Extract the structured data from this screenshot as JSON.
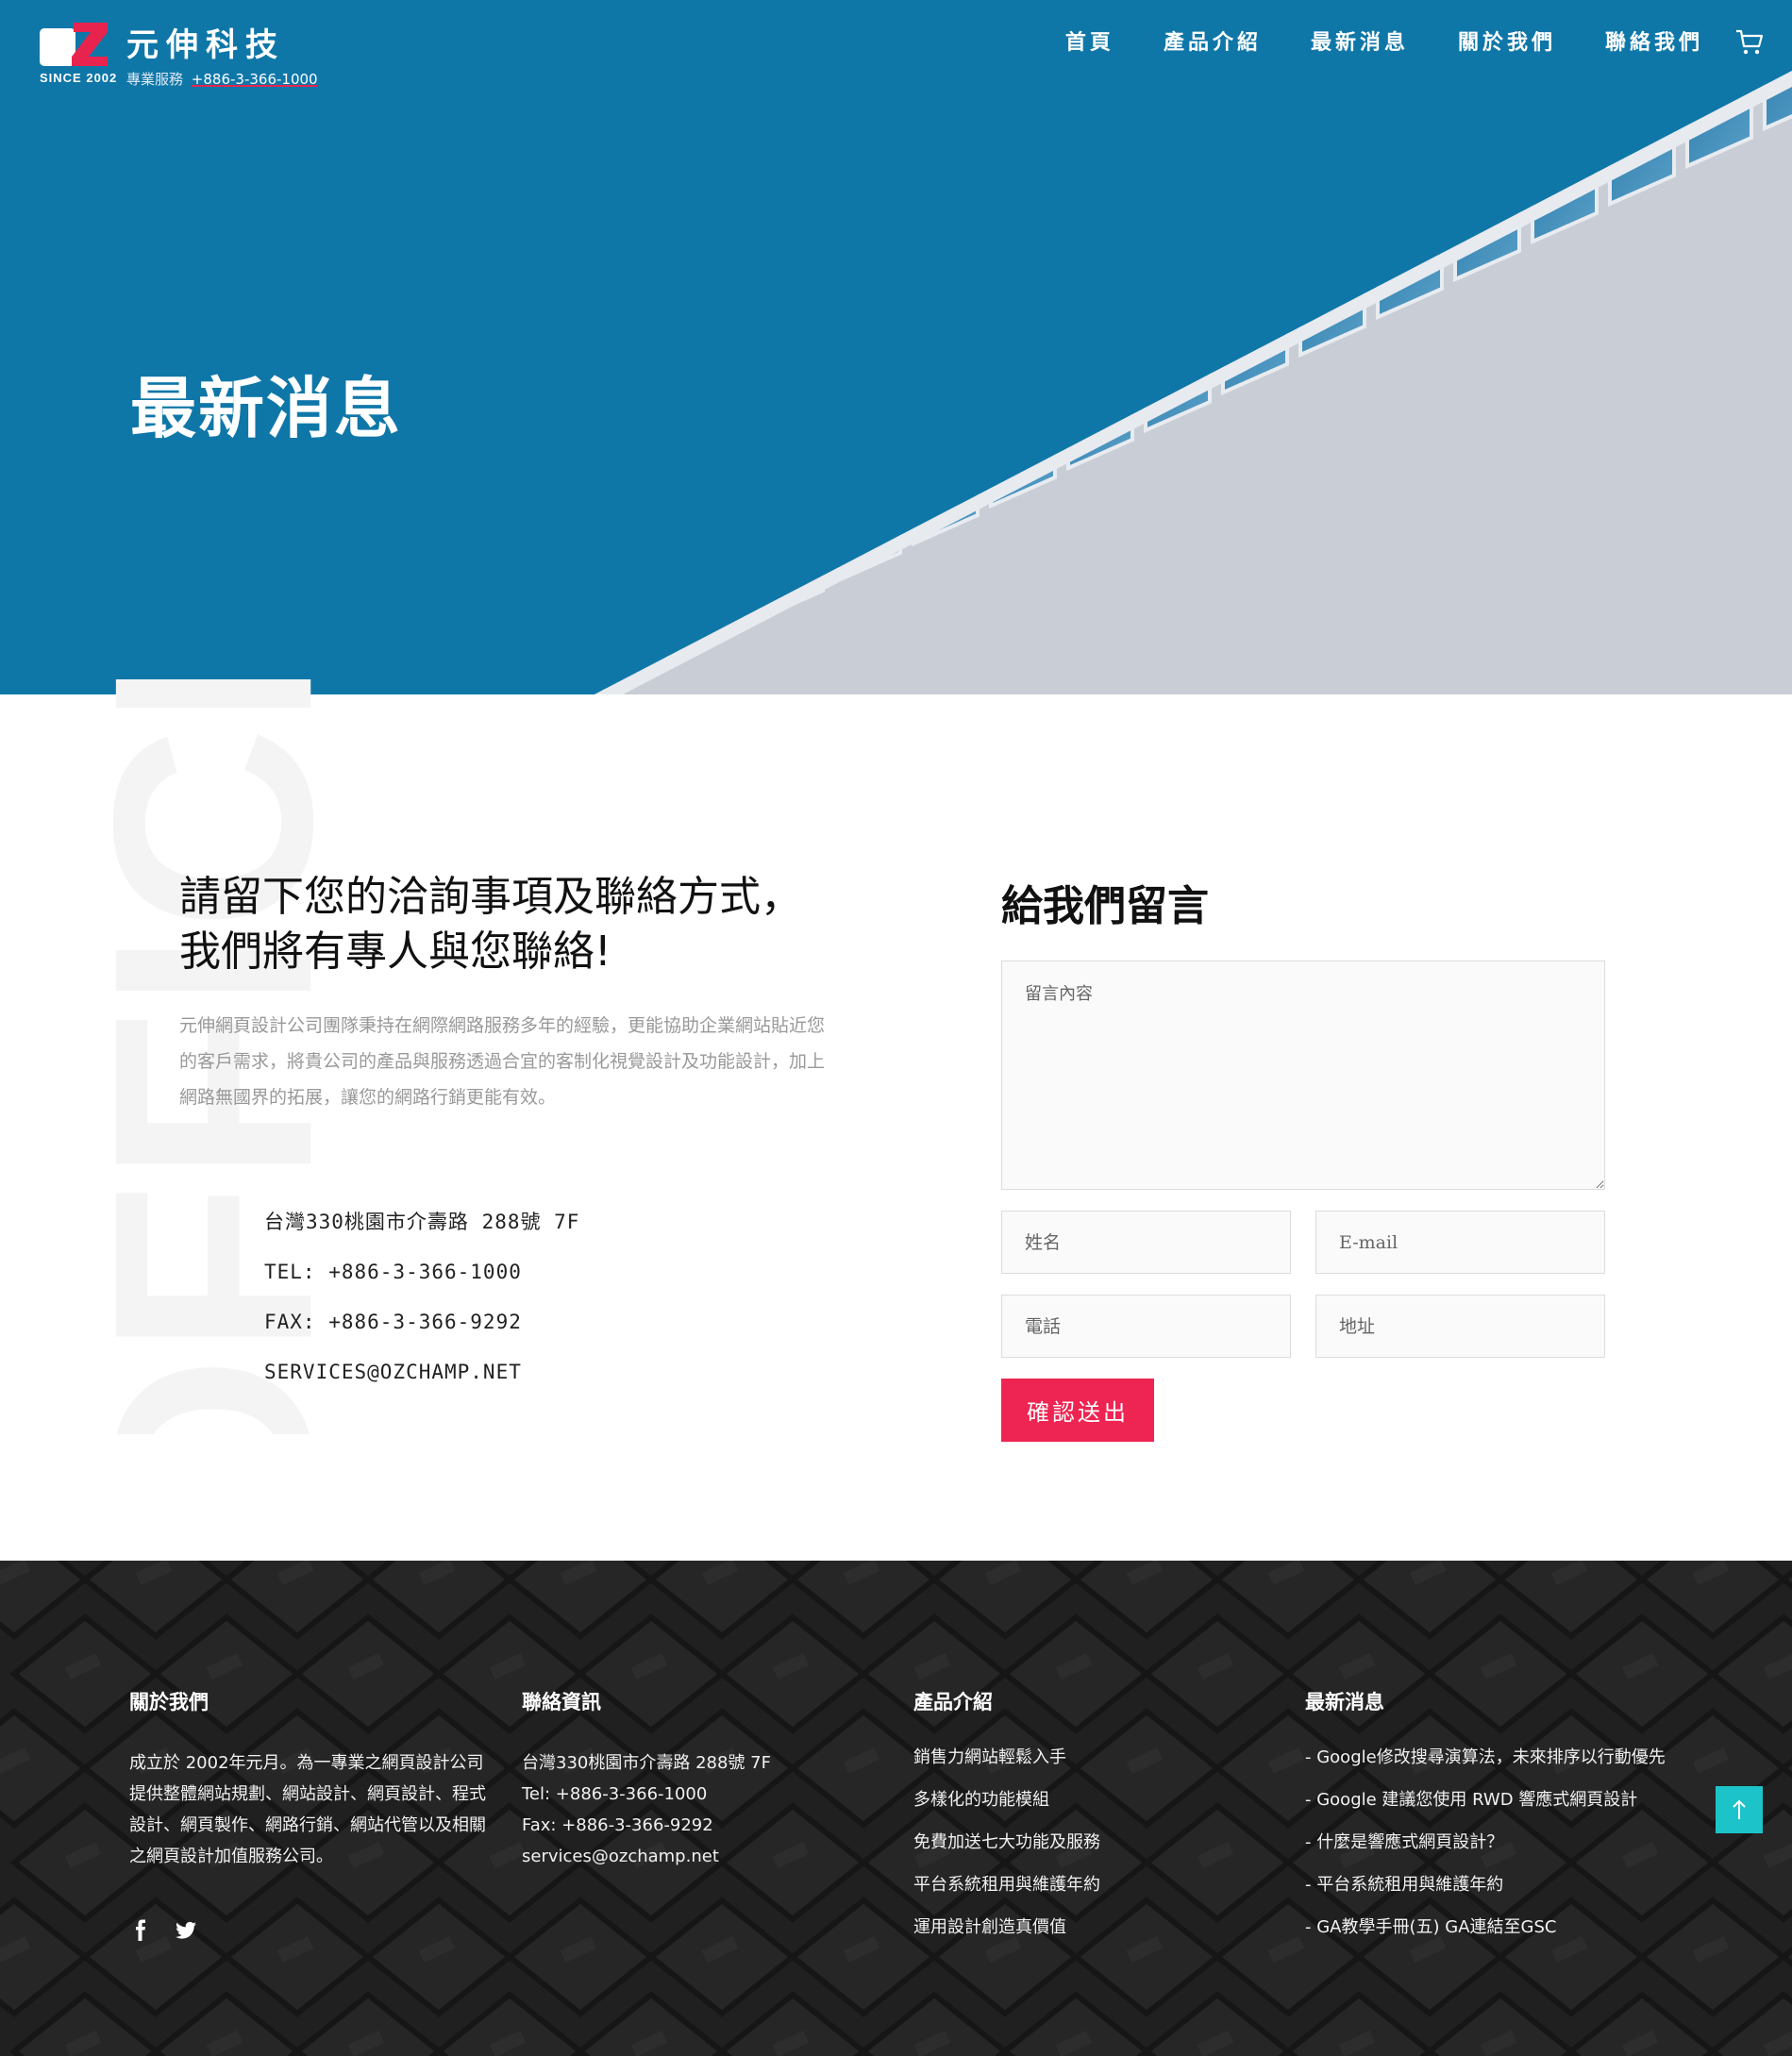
{
  "header": {
    "logo_since": "SINCE 2002",
    "logo_name": "元伸科技",
    "logo_sub_label": "專業服務",
    "logo_phone": "+886-3-366-1000",
    "nav": [
      {
        "label": "首頁"
      },
      {
        "label": "產品介紹"
      },
      {
        "label": "最新消息"
      },
      {
        "label": "關於我們"
      },
      {
        "label": "聯絡我們"
      }
    ],
    "cart_icon": "cart-icon"
  },
  "hero": {
    "title": "最新消息",
    "background_color": "#0f77a8"
  },
  "contact": {
    "headline_line1": "請留下您的洽詢事項及聯絡方式，",
    "headline_line2": "我們將有專人與您聯絡!",
    "intro": "元伸網頁設計公司團隊秉持在網際網路服務多年的經驗，更能協助企業網站貼近您的客戶需求，將貴公司的產品與服務透過合宜的客制化視覺設計及功能設計，加上網路無國界的拓展，讓您的網路行銷更能有效。",
    "address": "台灣330桃園市介壽路 288號 7F",
    "tel": "TEL: +886-3-366-1000",
    "fax": "FAX: +886-3-366-9292",
    "email": "SERVICES@OZCHAMP.NET",
    "watermark_text": "OFFICE"
  },
  "form": {
    "title": "給我們留言",
    "message_placeholder": "留言內容",
    "name_placeholder": "姓名",
    "email_placeholder": "E-mail",
    "phone_placeholder": "電話",
    "address_placeholder": "地址",
    "submit_label": "確認送出",
    "accent_color": "#ee2452"
  },
  "footer": {
    "about": {
      "heading": "關於我們",
      "text": "成立於 2002年元月。為一專業之網頁設計公司提供整體網站規劃、網站設計、網頁設計、程式設計、網頁製作、網路行銷、網站代管以及相關之網頁設計加值服務公司。"
    },
    "contact": {
      "heading": "聯絡資訊",
      "address": "台灣330桃園市介壽路 288號 7F",
      "tel": "Tel: +886-3-366-1000",
      "fax": "Fax: +886-3-366-9292",
      "email": "services@ozchamp.net"
    },
    "products": {
      "heading": "產品介紹",
      "items": [
        "銷售力網站輕鬆入手",
        "多樣化的功能模組",
        "免費加送七大功能及服務",
        "平台系統租用與維護年約",
        "運用設計創造真價值"
      ]
    },
    "news": {
      "heading": "最新消息",
      "items": [
        "- Google修改搜尋演算法，未來排序以行動優先",
        "- Google 建議您使用 RWD 響應式網頁設計",
        "- 什麼是響應式網頁設計？",
        "- 平台系統租用與維護年約",
        "- GA教學手冊(五) GA連結至GSC"
      ]
    },
    "social_icons": [
      "facebook-icon",
      "twitter-icon"
    ],
    "to_top_color": "#1cc4c9"
  }
}
